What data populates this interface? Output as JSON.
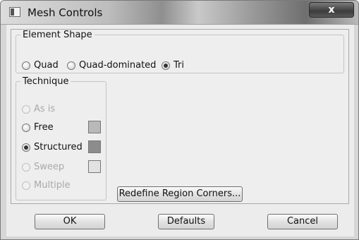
{
  "window": {
    "title": "Mesh Controls",
    "close_label": "x"
  },
  "element_shape": {
    "legend": "Element Shape",
    "options": [
      {
        "label": "Quad",
        "selected": false
      },
      {
        "label": "Quad-dominated",
        "selected": false
      },
      {
        "label": "Tri",
        "selected": true
      }
    ]
  },
  "technique": {
    "legend": "Technique",
    "options": [
      {
        "label": "As is",
        "selected": false,
        "enabled": false
      },
      {
        "label": "Free",
        "selected": false,
        "enabled": true,
        "swatch_color": "#b9b9b9"
      },
      {
        "label": "Structured",
        "selected": true,
        "enabled": true,
        "swatch_color": "#8c8c8c"
      },
      {
        "label": "Sweep",
        "selected": false,
        "enabled": false,
        "swatch_color": "#e2e2e2"
      },
      {
        "label": "Multiple",
        "selected": false,
        "enabled": false
      }
    ]
  },
  "buttons": {
    "redefine": "Redefine Region Corners...",
    "ok": "OK",
    "defaults": "Defaults",
    "cancel": "Cancel"
  }
}
